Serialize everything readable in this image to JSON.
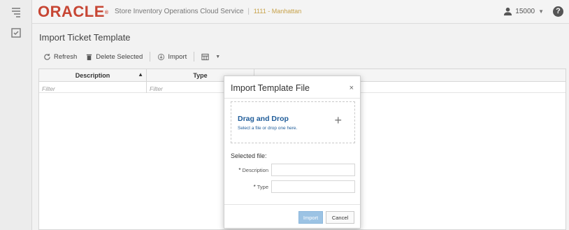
{
  "header": {
    "logo_text": "ORACLE",
    "logo_mark": "®",
    "product_name": "Store Inventory Operations Cloud Service",
    "separator": "|",
    "store_label": "1111 - Manhattan",
    "user_label": "15000",
    "user_icon": "user-icon",
    "help_label": "?"
  },
  "rail": {
    "items": [
      {
        "icon": "task-list-icon"
      },
      {
        "icon": "checkbox-icon"
      }
    ]
  },
  "page": {
    "title": "Import Ticket Template"
  },
  "toolbar": {
    "refresh_label": "Refresh",
    "delete_label": "Delete Selected",
    "import_label": "Import",
    "view_icon": "columns-icon"
  },
  "grid": {
    "columns": [
      {
        "label": "Description",
        "sorted": "ascending"
      },
      {
        "label": "Type"
      }
    ],
    "filter_placeholder": "Filter"
  },
  "modal": {
    "title": "Import Template File",
    "close_label": "×",
    "dropzone_title": "Drag and Drop",
    "dropzone_subtitle": "Select a file or drop one here.",
    "dropzone_plus": "+",
    "selected_file_label": "Selected file:",
    "description_label": "Description",
    "type_label": "Type",
    "required_mark": "*",
    "import_button": "Import",
    "cancel_button": "Cancel"
  },
  "colors": {
    "brand": "#c74634",
    "store_text": "#c7a24a",
    "link_blue": "#1f5c99",
    "primary_button_disabled": "#9cc3e4"
  }
}
